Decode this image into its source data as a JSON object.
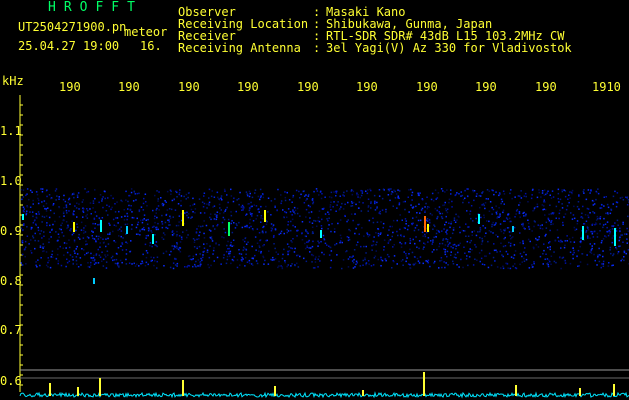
{
  "header": {
    "title": "HROFFT",
    "filename": "UT2504271900.pn",
    "file_suffix": "meteor",
    "timestamp": "25.04.27 19:00",
    "counter": "16.",
    "fields": [
      {
        "label": "Observer",
        "sep": ":",
        "value": "Masaki Kano"
      },
      {
        "label": "Receiving Location",
        "sep": ":",
        "value": "Shibukawa, Gunma, Japan"
      },
      {
        "label": "Receiver",
        "sep": ":",
        "value": "RTL-SDR SDR# 43dB L15 103.2MHz CW"
      },
      {
        "label": "Receiving Antenna",
        "sep": ":",
        "value": "3el Yagi(V) Az 330 for Vladivostok"
      }
    ]
  },
  "axis": {
    "y_unit": "kHz",
    "y_ticks": [
      "1.1",
      "1.0",
      "0.9",
      "0.8",
      "0.7",
      "0.6"
    ],
    "x_ticks": [
      "190",
      "190",
      "190",
      "190",
      "190",
      "190",
      "190",
      "190",
      "190",
      "1910"
    ]
  },
  "colors": {
    "text": "#ffff33",
    "title": "#00ff66",
    "trace": "#00e5ff",
    "background": "#000000"
  }
}
